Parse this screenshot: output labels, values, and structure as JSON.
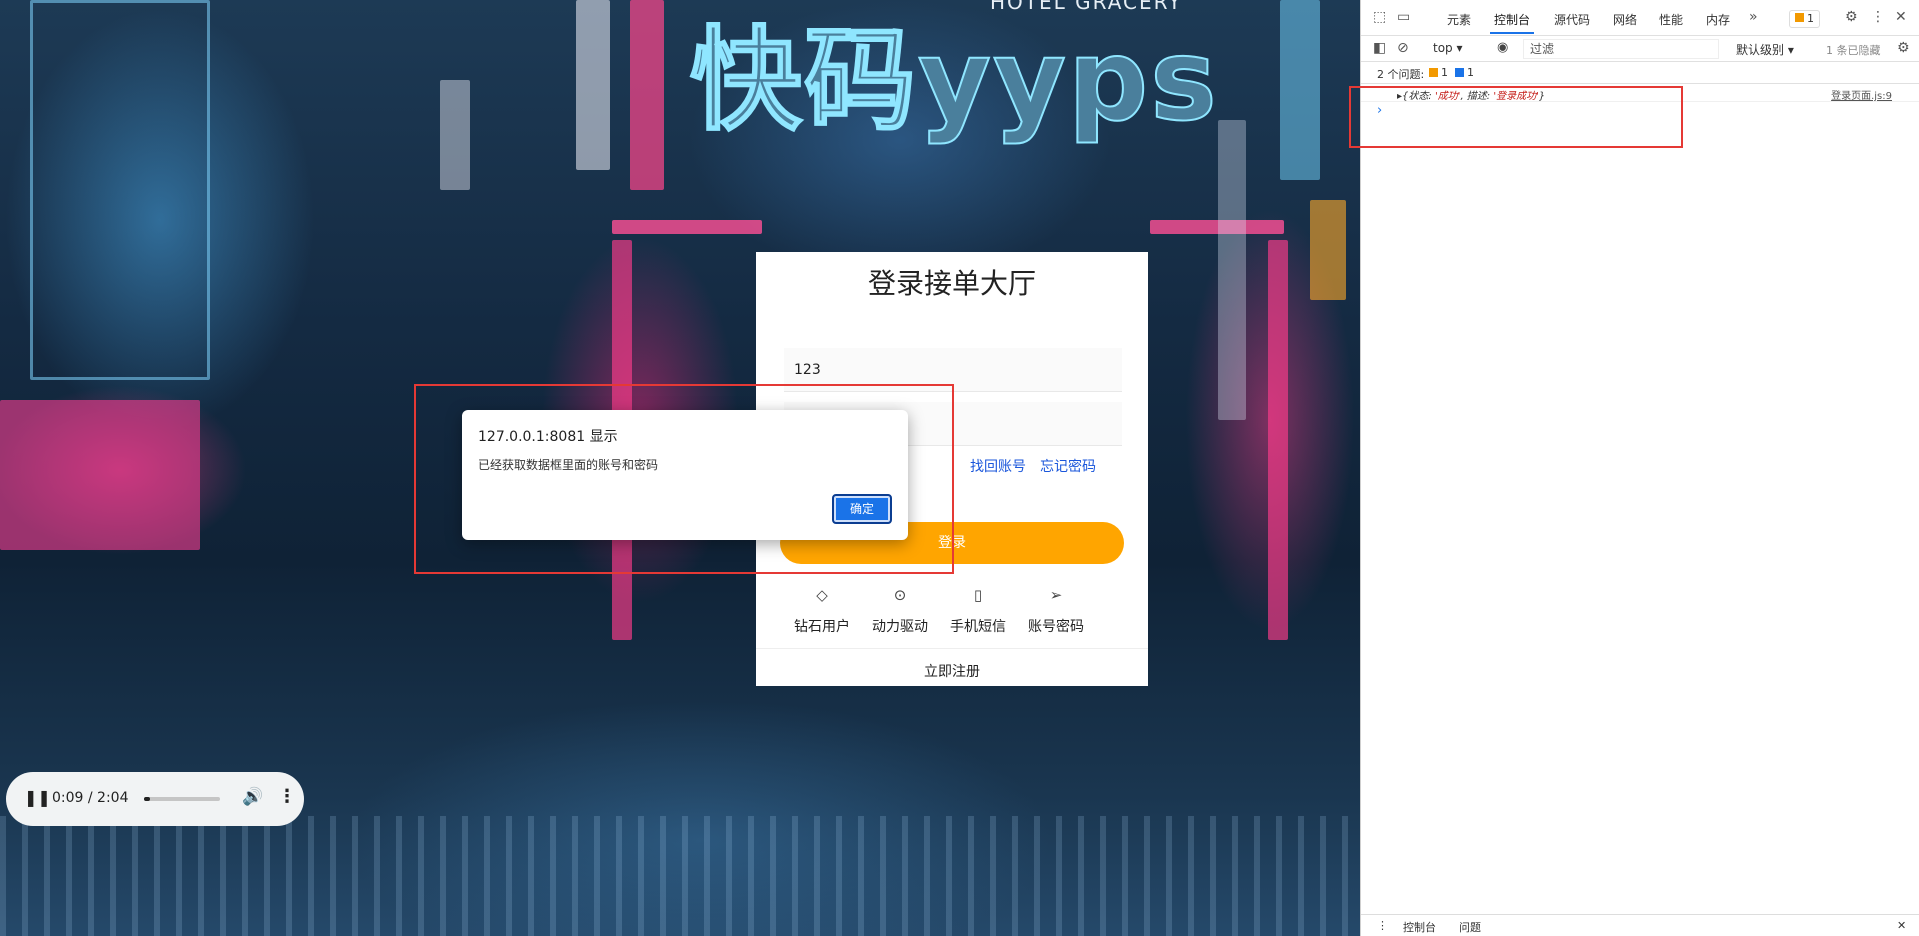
{
  "page": {
    "hero_title": "快码yyps",
    "hotel_sign": "HOTEL GRACERY"
  },
  "login": {
    "title": "登录接单大厅",
    "username_value": "123",
    "password_value": "",
    "link_recover": "找回账号",
    "link_forgot": "忘记密码",
    "login_button": "登录",
    "options": [
      {
        "icon": "diamond-icon",
        "label": "钻石用户"
      },
      {
        "icon": "power-icon",
        "label": "动力驱动"
      },
      {
        "icon": "phone-icon",
        "label": "手机短信"
      },
      {
        "icon": "send-icon",
        "label": "账号密码"
      }
    ],
    "register": "立即注册"
  },
  "alert": {
    "title": "127.0.0.1:8081 显示",
    "message": "已经获取数据框里面的账号和密码",
    "ok_button": "确定"
  },
  "audio": {
    "time": "0:09 / 2:04",
    "progress": 0.073
  },
  "devtools": {
    "tabs": [
      "元素",
      "控制台",
      "源代码",
      "网络",
      "性能",
      "内存"
    ],
    "active_tab": "控制台",
    "warning_badge": "1",
    "context": "top ▾",
    "filter_placeholder": "过滤",
    "levels": "默认级别 ▾",
    "hidden_count": "1 条已隐藏",
    "issues_text": "2 个问题:",
    "issue_warn_count": "1",
    "issue_info_count": "1",
    "log_prefix": "▸{状态: ",
    "log_status_value": "'成功'",
    "log_mid": ", 描述: ",
    "log_desc_value": "'登录成功'",
    "log_suffix": "}",
    "log_source": "登录页面.js:9",
    "prompt": "›",
    "drawer_console": "控制台",
    "drawer_issues": "问题"
  },
  "colors": {
    "login_button": "#ffa500",
    "link": "#1a56db",
    "highlight": "#e53935",
    "devtools_accent": "#1a73e8"
  }
}
